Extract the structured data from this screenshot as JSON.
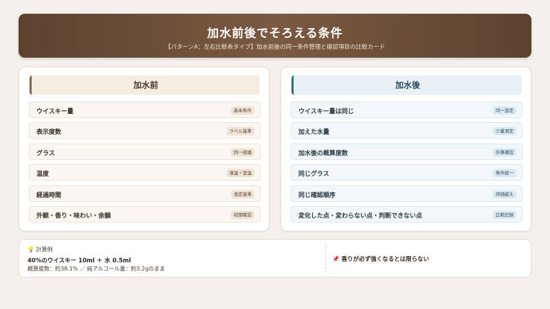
{
  "header": {
    "title": "加水前後でそろえる条件",
    "subtitle": "【パターンA：左右比較表タイプ】加水前後の同一条件整理と確認項目の比較カード"
  },
  "before": {
    "heading": "加水前",
    "items": [
      {
        "label": "ウイスキー量",
        "tag": "基本条件"
      },
      {
        "label": "表示度数",
        "tag": "ラベル基準"
      },
      {
        "label": "グラス",
        "tag": "同一容器"
      },
      {
        "label": "温度",
        "tag": "液温・室温"
      },
      {
        "label": "経過時間",
        "tag": "測定基準"
      },
      {
        "label": "外観・香り・味わい・余韻",
        "tag": "初期確認"
      }
    ]
  },
  "after": {
    "heading": "加水後",
    "items": [
      {
        "label": "ウイスキー量は同じ",
        "tag": "同一設定"
      },
      {
        "label": "加えた水量",
        "tag": "少量測定"
      },
      {
        "label": "加水後の概算度数",
        "tag": "計算確認"
      },
      {
        "label": "同じグラス",
        "tag": "条件統一"
      },
      {
        "label": "同じ確認順序",
        "tag": "評価揃え"
      },
      {
        "label": "変化した点・変わらない点・判断できない点",
        "tag": "比較記録"
      }
    ]
  },
  "note": {
    "calc_icon": "💡",
    "calc_label": "計算例",
    "calc_line1": "40%のウイスキー 10ml ＋ 水 0.5ml",
    "calc_line2": "概算度数：約38.1% ／ 純アルコール量：約3.2gのまま",
    "warn_icon": "📌",
    "warn_text": "香りが必ず強くなるとは限らない"
  }
}
